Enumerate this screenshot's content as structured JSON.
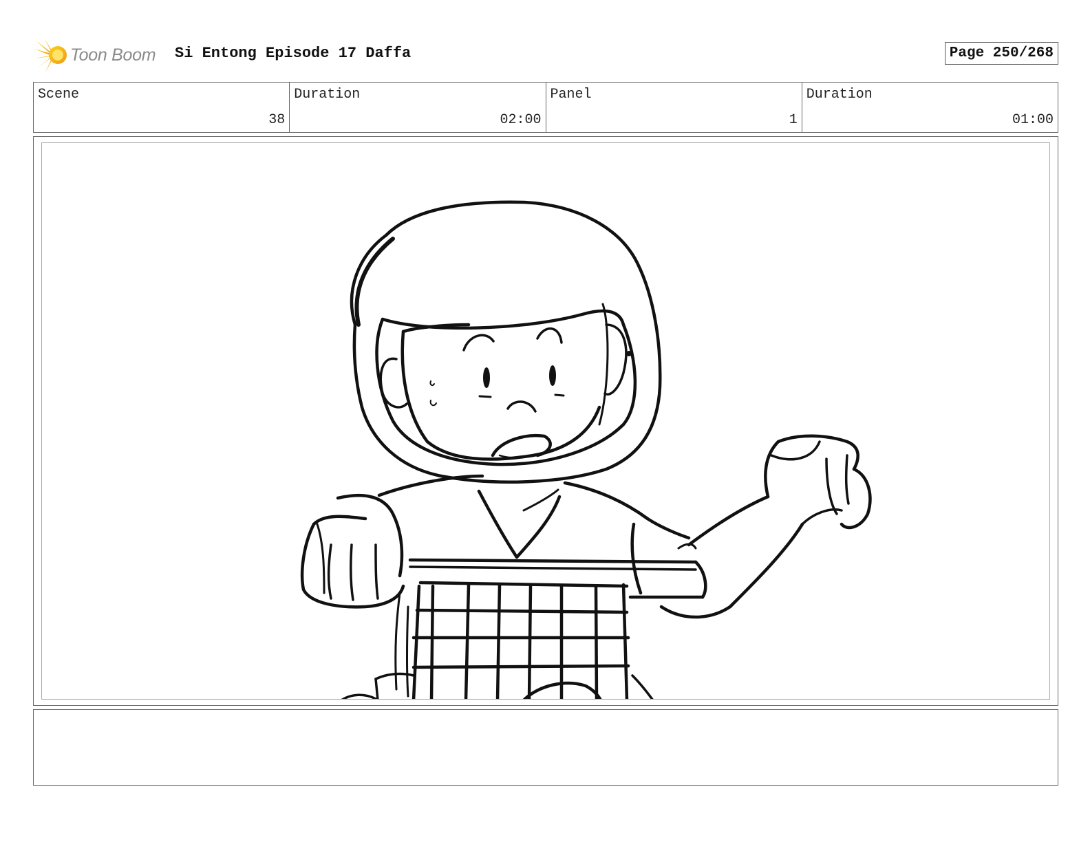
{
  "header": {
    "logo_text": "Toon Boom",
    "logo_icon": "starburst-icon",
    "title": "Si Entong Episode 17 Daffa",
    "page_label": "Page 250/268"
  },
  "info": {
    "scene_label": "Scene",
    "scene_value": "38",
    "scene_duration_label": "Duration",
    "scene_duration_value": "02:00",
    "panel_label": "Panel",
    "panel_value": "1",
    "panel_duration_label": "Duration",
    "panel_duration_value": "01:00"
  },
  "panel": {
    "image": "storyboard-sketch"
  },
  "notes": {
    "text": ""
  }
}
